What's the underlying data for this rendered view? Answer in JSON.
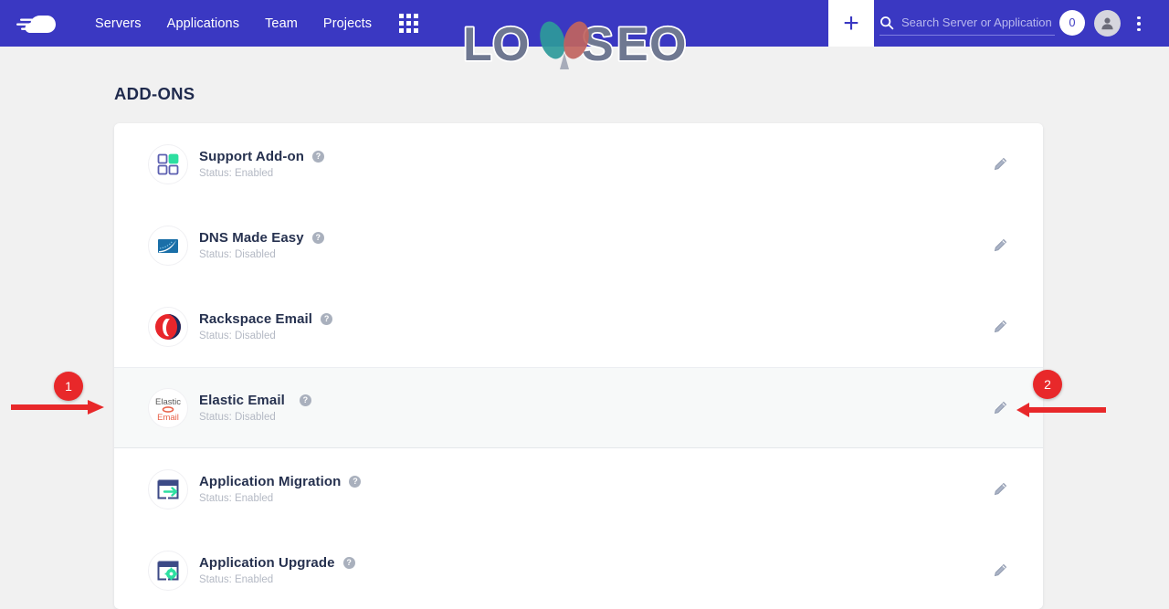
{
  "topbar": {
    "brand_icon": "cloudways-cloud-logo",
    "nav_links": [
      {
        "label": "Servers"
      },
      {
        "label": "Applications"
      },
      {
        "label": "Team"
      },
      {
        "label": "Projects"
      }
    ],
    "apps_grid_icon": "grid-apps-icon",
    "plus_label": "+",
    "search": {
      "icon": "search-icon",
      "placeholder": "Search Server or Application",
      "value": ""
    },
    "notification_count": "0",
    "avatar_icon": "user-avatar-icon",
    "kebab_icon": "more-vertical-icon",
    "background_color": "#3a38c2"
  },
  "watermark": {
    "text": "LOYSEO",
    "letters_color": "#6f7891",
    "balloon_teal": "#2e9a9a",
    "balloon_red": "#c1645e"
  },
  "page": {
    "title": "ADD-ONS"
  },
  "addons": [
    {
      "name": "Support Add-on",
      "status": "Status: Enabled",
      "icon": "support-squares-icon",
      "help": "?",
      "edit": "edit-pencil-icon",
      "highlighted": false
    },
    {
      "name": "DNS Made Easy",
      "status": "Status: Disabled",
      "icon": "dns-made-easy-icon",
      "help": "?",
      "edit": "edit-pencil-icon",
      "highlighted": false
    },
    {
      "name": "Rackspace Email",
      "status": "Status: Disabled",
      "icon": "rackspace-email-icon",
      "help": "?",
      "edit": "edit-pencil-icon",
      "highlighted": false
    },
    {
      "name": "Elastic Email",
      "status": "Status: Disabled",
      "icon": "elastic-email-icon",
      "help": "?",
      "edit": "edit-pencil-icon",
      "highlighted": true
    },
    {
      "name": "Application Migration",
      "status": "Status: Enabled",
      "icon": "application-migration-icon",
      "help": "?",
      "edit": "edit-pencil-icon",
      "highlighted": false
    },
    {
      "name": "Application Upgrade",
      "status": "Status: Enabled",
      "icon": "application-upgrade-icon",
      "help": "?",
      "edit": "edit-pencil-icon",
      "highlighted": false
    }
  ],
  "annotations": {
    "color": "#e8282a",
    "items": [
      {
        "number": "1",
        "points_to": "elastic-email-row"
      },
      {
        "number": "2",
        "points_to": "elastic-email-edit-pencil"
      }
    ]
  }
}
